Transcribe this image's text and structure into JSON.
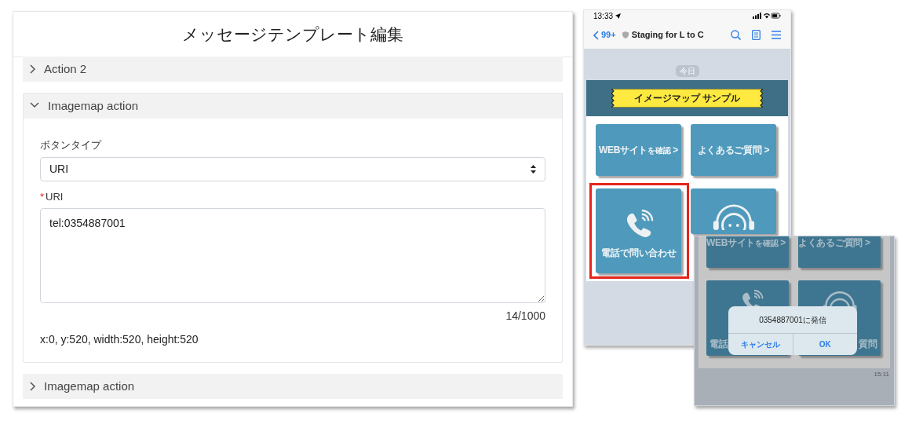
{
  "editor": {
    "title": "メッセージテンプレート編集",
    "sections": [
      {
        "label": "Action 2",
        "expanded": false
      },
      {
        "label": "Imagemap action",
        "expanded": true,
        "type_label": "ボタンタイプ",
        "type_value": "URI",
        "uri_label": "URI",
        "required_mark": "*",
        "uri_value": "tel:0354887001",
        "counter": "14/1000",
        "area": "x:0, y:520, width:520, height:520"
      },
      {
        "label": "Imagemap action",
        "expanded": false
      }
    ]
  },
  "chat_phone": {
    "time": "13:33",
    "back_count": "99+",
    "chat_title": "Staging for L to C",
    "date_chip": "今日",
    "banner": "イメージマップ サンプル",
    "tiles": [
      {
        "kind": "link",
        "label": "WEBサイト",
        "suffix": "を確認",
        "arrow": ">",
        "highlighted": false
      },
      {
        "kind": "link",
        "label": "よくあるご質問",
        "arrow": ">",
        "highlighted": false
      },
      {
        "kind": "phone",
        "label": "電話で問い合わせ",
        "highlighted": true
      },
      {
        "kind": "headset",
        "highlighted": false
      }
    ]
  },
  "dialog_phone": {
    "tiles": [
      {
        "kind": "link",
        "label": "WEBサイト",
        "suffix": "を確認",
        "arrow": ">"
      },
      {
        "kind": "link",
        "label": "よくあるご質問",
        "arrow": ">"
      },
      {
        "kind": "phone",
        "label": "電話"
      },
      {
        "kind": "headset",
        "label": "質問"
      }
    ],
    "dialog": {
      "message": "0354887001に発信",
      "buttons": [
        "キャンセル",
        "OK"
      ]
    },
    "time": "15:11"
  }
}
